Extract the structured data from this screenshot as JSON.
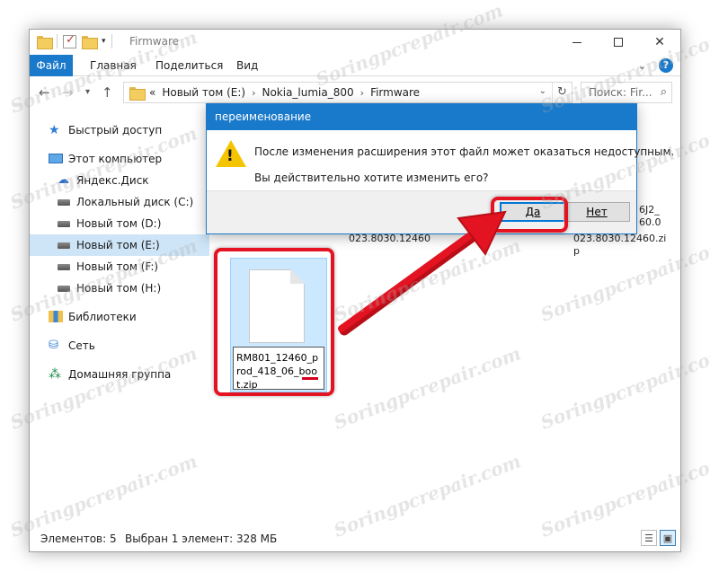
{
  "window": {
    "title": "Firmware",
    "ribbon_tabs": [
      "Файл",
      "Главная",
      "Поделиться",
      "Вид"
    ]
  },
  "address": {
    "overflow": "«",
    "crumbs": [
      "Новый том (E:)",
      "Nokia_lumia_800",
      "Firmware"
    ],
    "search_placeholder": "Поиск: Fir..."
  },
  "sidebar": {
    "items": [
      {
        "label": "Быстрый доступ",
        "icon": "star-icon"
      },
      {
        "label": "Этот компьютер",
        "icon": "computer-icon"
      },
      {
        "label": "Яндекс.Диск",
        "icon": "yandex-disk-icon"
      },
      {
        "label": "Локальный диск (C:)",
        "icon": "drive-icon"
      },
      {
        "label": "Новый том (D:)",
        "icon": "drive-icon"
      },
      {
        "label": "Новый том (E:)",
        "icon": "drive-icon",
        "selected": true
      },
      {
        "label": "Новый том (F:)",
        "icon": "drive-icon"
      },
      {
        "label": "Новый том (H:)",
        "icon": "drive-icon"
      },
      {
        "label": "Библиотеки",
        "icon": "libraries-icon"
      },
      {
        "label": "Сеть",
        "icon": "network-icon"
      },
      {
        "label": "Домашняя группа",
        "icon": "homegroup-icon"
      }
    ]
  },
  "files": {
    "frag_left": "023.8030.12460",
    "frag_right": [
      "6J2_",
      "60.0",
      "023.8030.12460.zi",
      "p"
    ],
    "selected_name": "RM801_12460_prod_418_06_boot.zip"
  },
  "status": {
    "items_count": "Элементов: 5",
    "selection": "Выбран 1 элемент: 328 МБ"
  },
  "dialog": {
    "title": "переименование",
    "message": "После изменения расширения этот файл может оказаться недоступным.",
    "question": "Вы действительно хотите изменить его?",
    "yes_label": "Да",
    "no_label": "Нет"
  },
  "watermark": "Soringpcrepair.com",
  "colors": {
    "accent": "#1979ca",
    "highlight": "#e31321",
    "selection": "#cce8ff"
  }
}
